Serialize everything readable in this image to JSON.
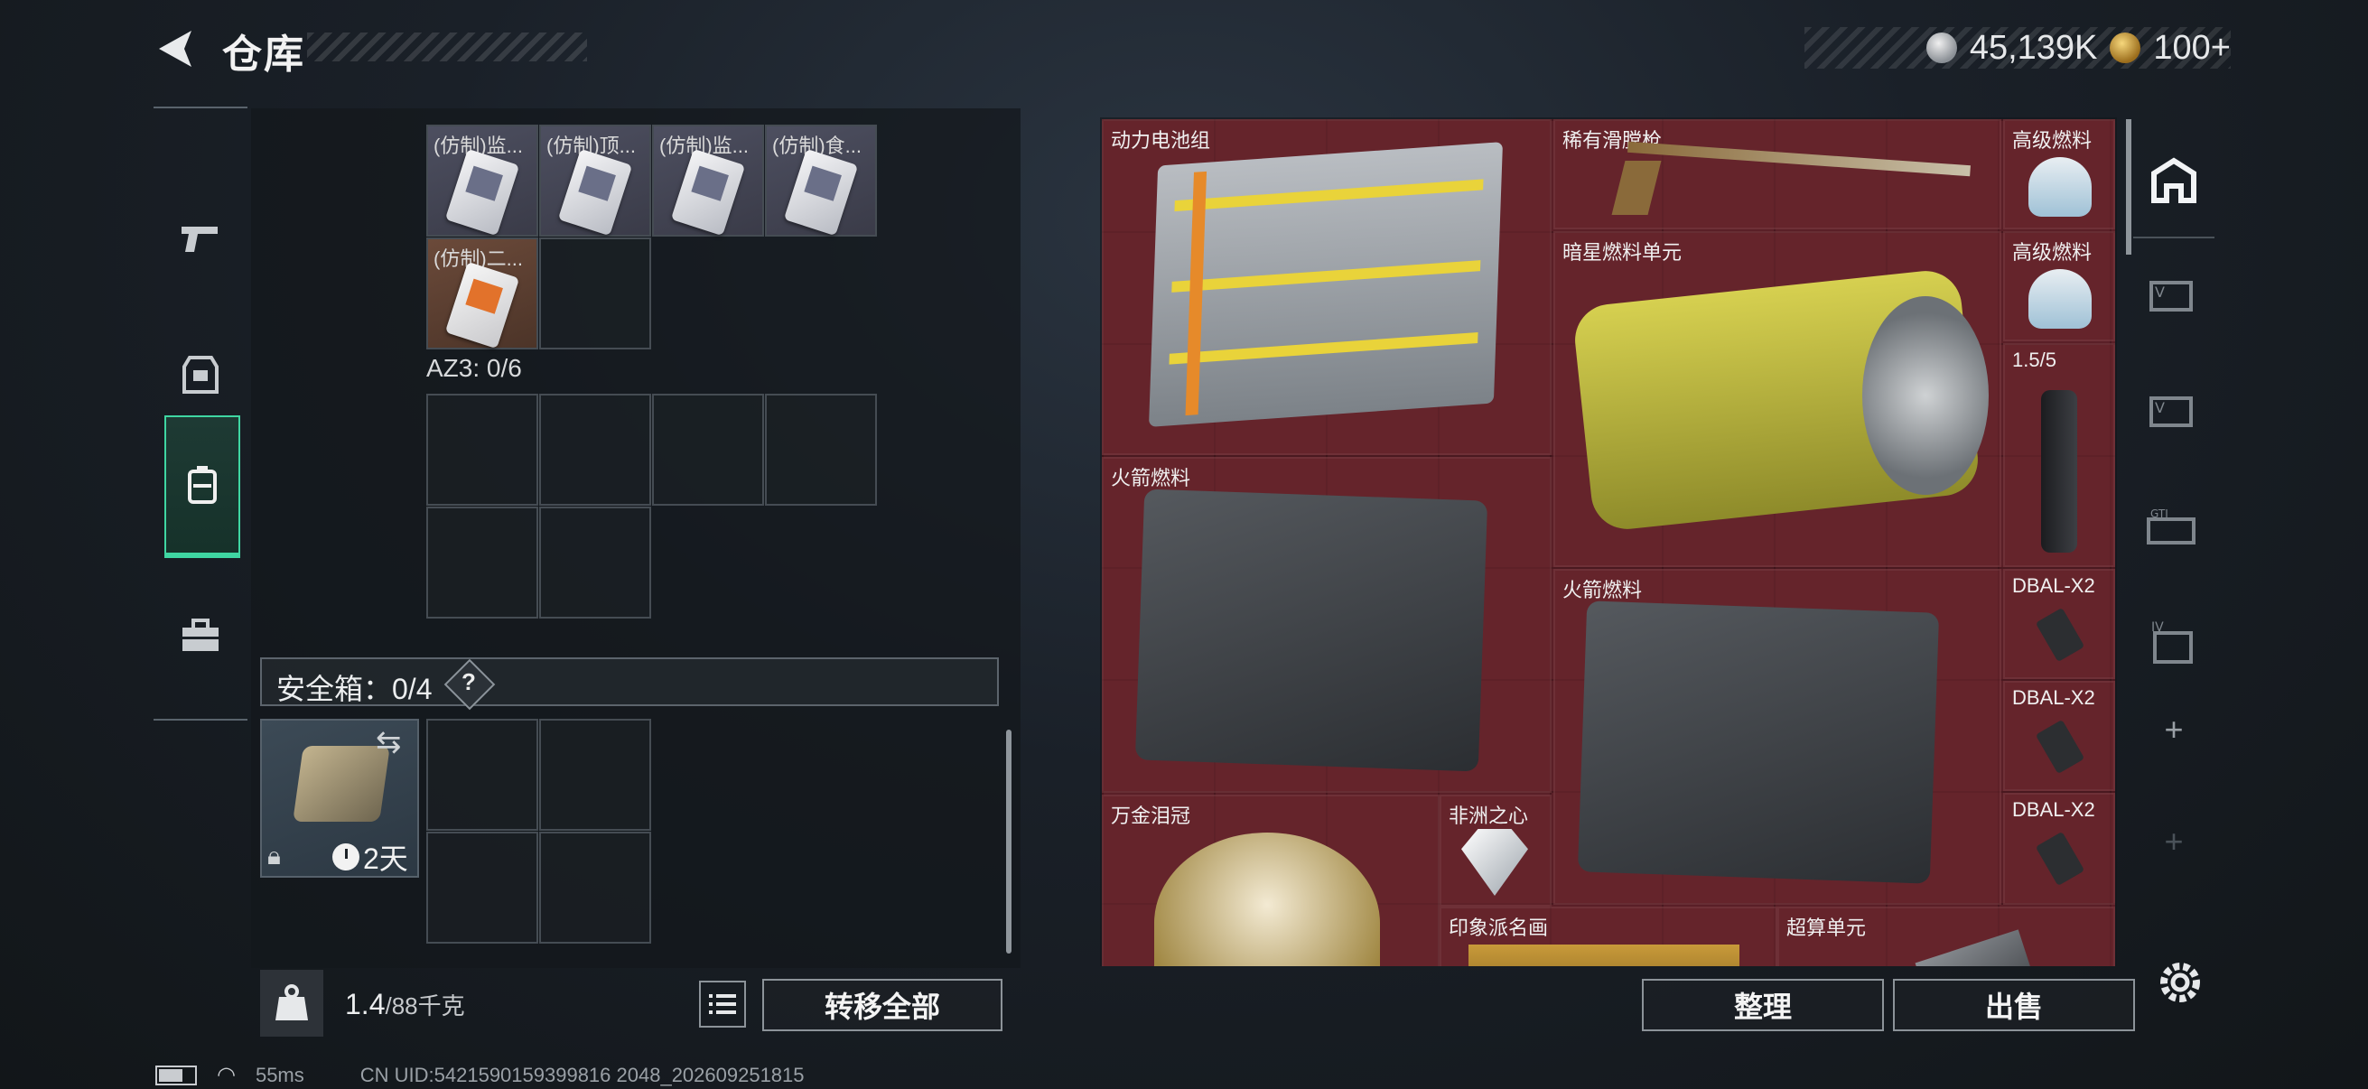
{
  "header": {
    "title": "仓库",
    "silver": "45,139K",
    "gold": "100+"
  },
  "rail": {
    "items": [
      "weapon",
      "armor",
      "backpack",
      "case"
    ]
  },
  "left": {
    "top_items": [
      {
        "label": "(仿制)监..."
      },
      {
        "label": "(仿制)顶..."
      },
      {
        "label": "(仿制)监..."
      },
      {
        "label": "(仿制)食..."
      },
      {
        "label": "(仿制)二..."
      }
    ],
    "az3_label": "AZ3: 0/6",
    "safe_label": "安全箱：0/4",
    "safe_help": "?",
    "timer": "2天",
    "weight_main": "1.4",
    "weight_unit": "/88千克",
    "transfer_all": "转移全部"
  },
  "stash": {
    "items": [
      {
        "label": "动力电池组"
      },
      {
        "label": "稀有滑膛枪"
      },
      {
        "label": "高级燃料"
      },
      {
        "label": "暗星燃料单元"
      },
      {
        "label": "高级燃料"
      },
      {
        "label": "1.5/5"
      },
      {
        "label": "火箭燃料"
      },
      {
        "label": "火箭燃料"
      },
      {
        "label": "DBAL-X2"
      },
      {
        "label": "DBAL-X2"
      },
      {
        "label": "DBAL-X2"
      },
      {
        "label": "万金泪冠"
      },
      {
        "label": "非洲之心"
      },
      {
        "label": "印象派名画"
      },
      {
        "label": "超算单元"
      }
    ],
    "sort_btn": "整理",
    "sell_btn": "出售"
  },
  "status": {
    "ping": "55ms",
    "uid": "CN UID:5421590159399816 2048_202609251815"
  }
}
